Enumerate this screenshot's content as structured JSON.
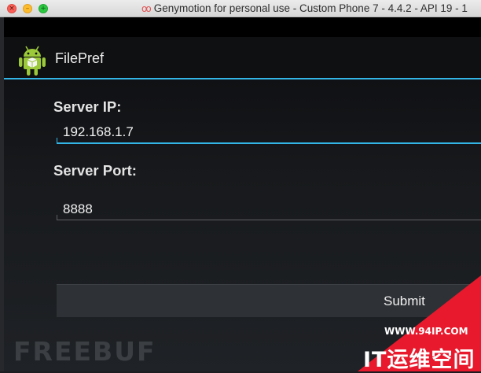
{
  "window": {
    "title": "Genymotion for personal use - Custom Phone 7 - 4.4.2 - API 19 - 1",
    "logo_glyph": "oo",
    "close_glyph": "×",
    "minimize_glyph": "–",
    "maximize_glyph": "+"
  },
  "app": {
    "title": "FilePref",
    "accent_color": "#33b5e5"
  },
  "form": {
    "server_ip_label": "Server IP:",
    "server_ip_value": "192.168.1.7",
    "server_port_label": "Server Port:",
    "server_port_value": "8888",
    "submit_label": "Submit"
  },
  "watermark": {
    "text": "FREEBUF",
    "corner_url": "WWW.94IP.COM",
    "corner_brand": "IT运维空间",
    "corner_color": "#e8192c"
  }
}
